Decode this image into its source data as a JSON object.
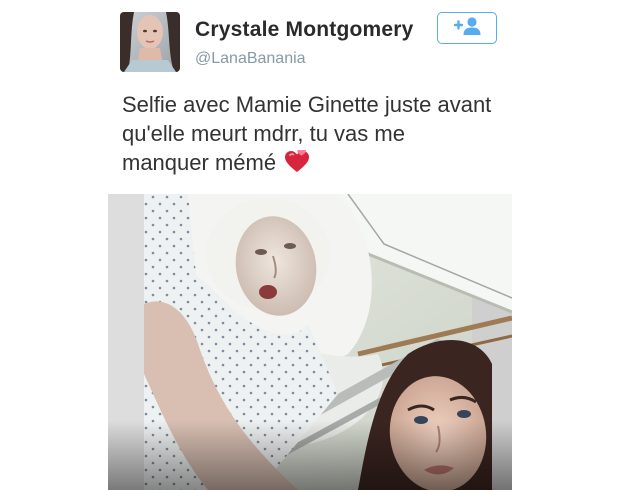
{
  "tweet": {
    "user": {
      "display_name": "Crystale Montgomery",
      "screen_name": "@LanaBanania"
    },
    "follow_icon": "add-user-icon",
    "text_lines": [
      "Selfie avec Mamie Ginette juste avant",
      "qu'elle meurt mdrr, tu vas me",
      "manquer mémé"
    ],
    "emoji": "revolving-hearts-icon",
    "colors": {
      "accent": "#55acee",
      "name": "#2a2a2a",
      "handle": "#8899a6",
      "text": "#333333"
    }
  }
}
